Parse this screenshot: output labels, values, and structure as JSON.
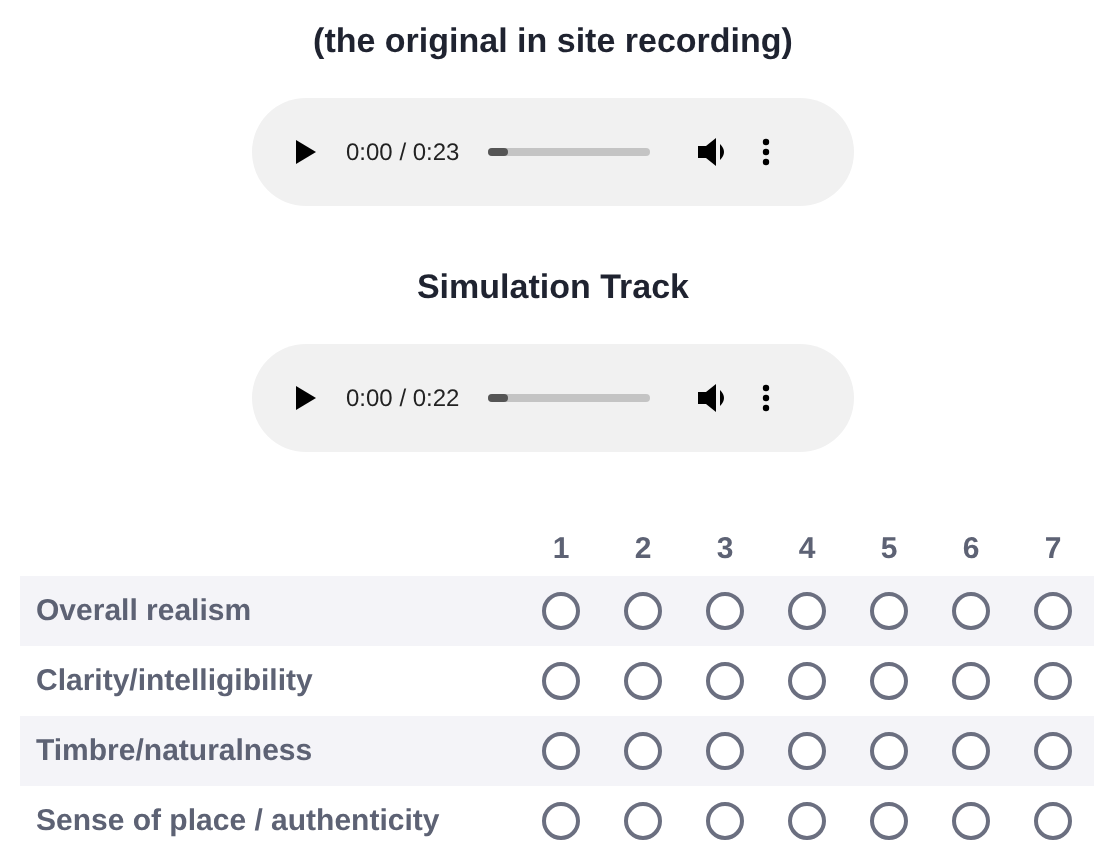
{
  "sections": [
    {
      "heading": "(the original in site recording)",
      "player": {
        "time": "0:00 / 0:23"
      }
    },
    {
      "heading": "Simulation Track",
      "player": {
        "time": "0:00 / 0:22"
      }
    }
  ],
  "rating_table": {
    "columns": [
      "1",
      "2",
      "3",
      "4",
      "5",
      "6",
      "7"
    ],
    "rows": [
      {
        "label": "Overall realism",
        "options": [
          {
            "selected": false
          },
          {
            "selected": false
          },
          {
            "selected": false
          },
          {
            "selected": false
          },
          {
            "selected": false
          },
          {
            "selected": false
          },
          {
            "selected": false
          }
        ]
      },
      {
        "label": "Clarity/intelligibility",
        "options": [
          {
            "selected": false
          },
          {
            "selected": false
          },
          {
            "selected": false
          },
          {
            "selected": false
          },
          {
            "selected": false
          },
          {
            "selected": false
          },
          {
            "selected": false
          }
        ]
      },
      {
        "label": "Timbre/naturalness",
        "options": [
          {
            "selected": false
          },
          {
            "selected": false
          },
          {
            "selected": false
          },
          {
            "selected": false
          },
          {
            "selected": false
          },
          {
            "selected": false
          },
          {
            "selected": false
          }
        ]
      },
      {
        "label": "Sense of place / authenticity",
        "options": [
          {
            "selected": false
          },
          {
            "selected": false
          },
          {
            "selected": false
          },
          {
            "selected": false
          },
          {
            "selected": false
          },
          {
            "selected": false
          },
          {
            "selected": false
          }
        ]
      }
    ]
  }
}
